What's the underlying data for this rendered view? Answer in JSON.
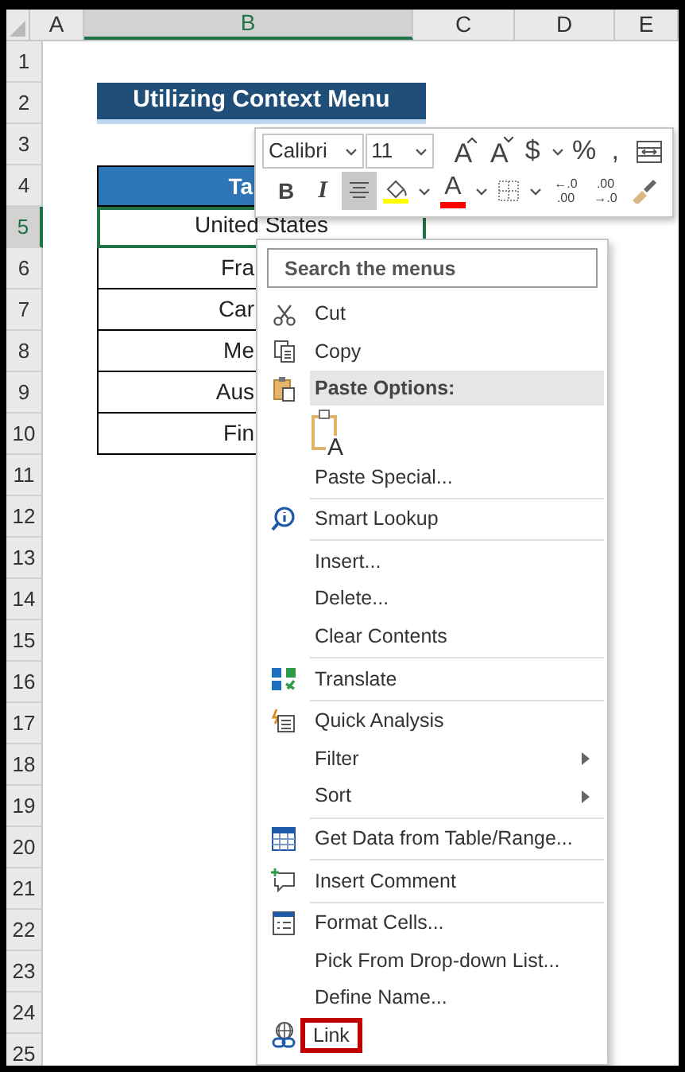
{
  "columns": [
    {
      "label": "A",
      "selected": false
    },
    {
      "label": "B",
      "selected": true
    },
    {
      "label": "C",
      "selected": false
    },
    {
      "label": "D",
      "selected": false
    },
    {
      "label": "E",
      "selected": false
    }
  ],
  "rows": [
    {
      "label": "1",
      "selected": false
    },
    {
      "label": "2",
      "selected": false
    },
    {
      "label": "3",
      "selected": false
    },
    {
      "label": "4",
      "selected": false
    },
    {
      "label": "5",
      "selected": true
    },
    {
      "label": "6",
      "selected": false
    },
    {
      "label": "7",
      "selected": false
    },
    {
      "label": "8",
      "selected": false
    },
    {
      "label": "9",
      "selected": false
    },
    {
      "label": "10",
      "selected": false
    },
    {
      "label": "11",
      "selected": false
    },
    {
      "label": "12",
      "selected": false
    },
    {
      "label": "13",
      "selected": false
    },
    {
      "label": "14",
      "selected": false
    },
    {
      "label": "15",
      "selected": false
    },
    {
      "label": "16",
      "selected": false
    },
    {
      "label": "17",
      "selected": false
    },
    {
      "label": "18",
      "selected": false
    },
    {
      "label": "19",
      "selected": false
    },
    {
      "label": "20",
      "selected": false
    },
    {
      "label": "21",
      "selected": false
    },
    {
      "label": "22",
      "selected": false
    },
    {
      "label": "23",
      "selected": false
    },
    {
      "label": "24",
      "selected": false
    },
    {
      "label": "25",
      "selected": false
    }
  ],
  "sheet": {
    "title": "Utilizing Context Menu",
    "table_header": "Ta",
    "table_rows": [
      {
        "text": "United States",
        "selected": true
      },
      {
        "text": "Fra",
        "selected": false
      },
      {
        "text": "Car",
        "selected": false
      },
      {
        "text": "Me",
        "selected": false
      },
      {
        "text": "Aus",
        "selected": false
      },
      {
        "text": "Fin",
        "selected": false
      }
    ]
  },
  "mini_toolbar": {
    "font_name": "Calibri",
    "font_size": "11",
    "top_row": [
      {
        "kind": "grow",
        "label": "A",
        "selected": false
      },
      {
        "kind": "shrink",
        "label": "A",
        "selected": false
      },
      {
        "kind": "text",
        "label": "$",
        "selected": false
      },
      {
        "kind": "chevron",
        "selected": false
      },
      {
        "kind": "text",
        "label": "%",
        "selected": false
      },
      {
        "kind": "text",
        "label": ",",
        "selected": false
      },
      {
        "kind": "wrap",
        "selected": false
      }
    ],
    "bottom_row": [
      {
        "kind": "bold",
        "label": "B",
        "selected": false
      },
      {
        "kind": "italic",
        "label": "I",
        "selected": false
      },
      {
        "kind": "align",
        "selected": true
      },
      {
        "kind": "fill",
        "color": "#ffff00",
        "selected": false
      },
      {
        "kind": "chevron",
        "selected": false
      },
      {
        "kind": "fontcolor",
        "label": "A",
        "color": "#ff0000",
        "selected": false
      },
      {
        "kind": "chevron",
        "selected": false
      },
      {
        "kind": "borders",
        "selected": false
      },
      {
        "kind": "chevron",
        "selected": false
      },
      {
        "kind": "decimal",
        "lines": [
          "←.0",
          ".00"
        ],
        "selected": false
      },
      {
        "kind": "decimal",
        "lines": [
          ".00",
          "→.0"
        ],
        "selected": false
      },
      {
        "kind": "painter",
        "selected": false
      }
    ]
  },
  "context_menu": {
    "search": {
      "placeholder": "Search the menus"
    },
    "items": [
      {
        "kind": "item",
        "label": "Cut",
        "has_icon": true,
        "submenu": false,
        "highlighted": false
      },
      {
        "kind": "item",
        "label": "Copy",
        "has_icon": true,
        "submenu": false,
        "highlighted": false
      },
      {
        "kind": "header",
        "label": "Paste Options:",
        "has_icon": true,
        "highlighted": false
      },
      {
        "kind": "paste_option",
        "label": "A",
        "has_icon": false,
        "highlighted": false
      },
      {
        "kind": "item",
        "label": "Paste Special...",
        "has_icon": false,
        "submenu": false,
        "highlighted": false
      },
      {
        "kind": "separator"
      },
      {
        "kind": "item",
        "label": "Smart Lookup",
        "has_icon": true,
        "submenu": false,
        "highlighted": false
      },
      {
        "kind": "separator"
      },
      {
        "kind": "item",
        "label": "Insert...",
        "has_icon": false,
        "submenu": false,
        "highlighted": false
      },
      {
        "kind": "item",
        "label": "Delete...",
        "has_icon": false,
        "submenu": false,
        "highlighted": false
      },
      {
        "kind": "item",
        "label": "Clear Contents",
        "has_icon": false,
        "submenu": false,
        "highlighted": false
      },
      {
        "kind": "separator"
      },
      {
        "kind": "item",
        "label": "Translate",
        "has_icon": true,
        "submenu": false,
        "highlighted": false
      },
      {
        "kind": "separator"
      },
      {
        "kind": "item",
        "label": "Quick Analysis",
        "has_icon": true,
        "submenu": false,
        "highlighted": false
      },
      {
        "kind": "item",
        "label": "Filter",
        "has_icon": false,
        "submenu": true,
        "highlighted": false
      },
      {
        "kind": "item",
        "label": "Sort",
        "has_icon": false,
        "submenu": true,
        "highlighted": false
      },
      {
        "kind": "separator"
      },
      {
        "kind": "item",
        "label": "Get Data from Table/Range...",
        "has_icon": true,
        "submenu": false,
        "highlighted": false
      },
      {
        "kind": "separator"
      },
      {
        "kind": "item",
        "label": "Insert Comment",
        "has_icon": true,
        "submenu": false,
        "highlighted": false
      },
      {
        "kind": "separator"
      },
      {
        "kind": "item",
        "label": "Format Cells...",
        "has_icon": true,
        "submenu": false,
        "highlighted": false
      },
      {
        "kind": "item",
        "label": "Pick From Drop-down List...",
        "has_icon": false,
        "submenu": false,
        "highlighted": false
      },
      {
        "kind": "item",
        "label": "Define Name...",
        "has_icon": false,
        "submenu": false,
        "highlighted": false
      },
      {
        "kind": "item",
        "label": "Link",
        "has_icon": true,
        "submenu": false,
        "highlighted": true
      }
    ]
  }
}
